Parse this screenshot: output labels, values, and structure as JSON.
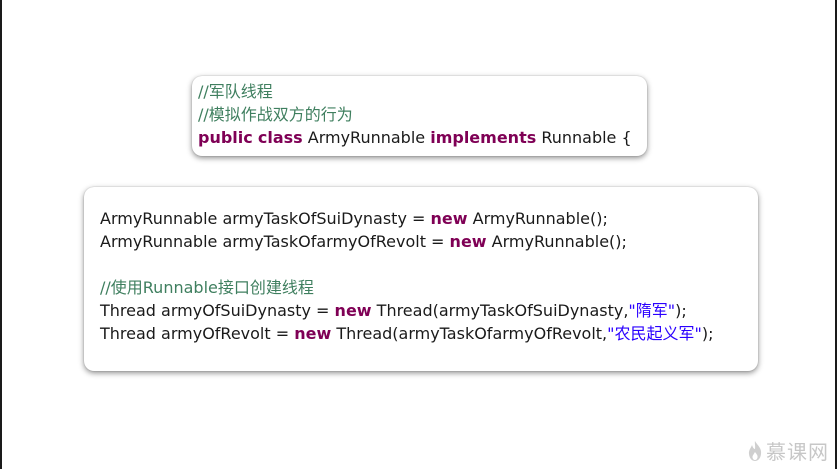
{
  "top_card": {
    "comment_line1": "//军队线程",
    "comment_line2": "//模拟作战双方的行为",
    "kw_public": "public",
    "kw_class": "class",
    "class_name": " ArmyRunnable ",
    "kw_implements": "implements",
    "tail": " Runnable {"
  },
  "main_card": {
    "line1": {
      "prefix": "ArmyRunnable armyTaskOfSuiDynasty = ",
      "kw": "new",
      "suffix": " ArmyRunnable();"
    },
    "line2": {
      "prefix": "ArmyRunnable armyTaskOfarmyOfRevolt = ",
      "kw": "new",
      "suffix": " ArmyRunnable();"
    },
    "comment": "//使用Runnable接口创建线程",
    "line3": {
      "prefix": "Thread armyOfSuiDynasty = ",
      "kw": "new",
      "mid": " Thread(armyTaskOfSuiDynasty,",
      "str": "\"隋军\"",
      "suffix": ");"
    },
    "line4": {
      "prefix": "Thread armyOfRevolt = ",
      "kw": "new",
      "mid": " Thread(armyTaskOfarmyOfRevolt,",
      "str": "\"农民起义军\"",
      "suffix": ");"
    }
  },
  "watermark": {
    "text": "慕课网",
    "icon": "flame-icon"
  },
  "colors": {
    "comment": "#3f7f5f",
    "keyword": "#7f0055",
    "string": "#2a00ff",
    "text": "#1a1a1a"
  }
}
